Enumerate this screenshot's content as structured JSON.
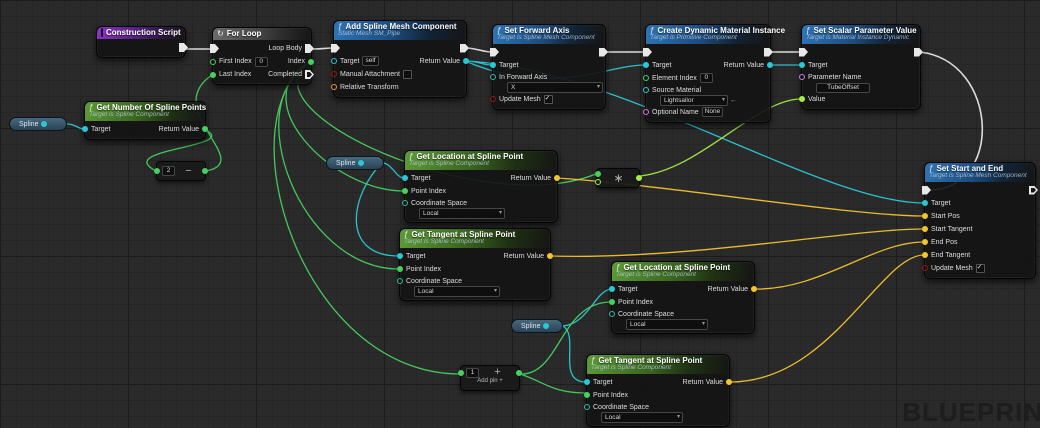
{
  "watermark": "BLUEPRINT",
  "colors": {
    "exec": "#e6e6e6",
    "object": "#2bc8d6",
    "int": "#46d05f",
    "float": "#a3ee44",
    "vector": "#f3c431"
  },
  "icons": {
    "function": "ƒ",
    "loop": "↻",
    "asset_use": "←"
  },
  "nodes": {
    "construction_script": {
      "title": "Construction Script"
    },
    "for_loop": {
      "title": "For Loop",
      "first_index_label": "First Index",
      "first_index_value": "0",
      "last_index_label": "Last Index",
      "loop_body_label": "Loop Body",
      "index_label": "Index",
      "completed_label": "Completed"
    },
    "add_spline_mesh": {
      "title": "Add Spline Mesh Component",
      "subtitle": "Static Mesh SM_Pipe",
      "target_label": "Target",
      "target_value": "self",
      "manual_attachment_label": "Manual Attachment",
      "relative_transform_label": "Relative Transform",
      "return_value_label": "Return Value"
    },
    "set_forward_axis": {
      "title": "Set Forward Axis",
      "subtitle": "Target is Spline Mesh Component",
      "target_label": "Target",
      "in_forward_axis_label": "In Forward Axis",
      "in_forward_axis_value": "X",
      "update_mesh_label": "Update Mesh"
    },
    "create_dynamic_material": {
      "title": "Create Dynamic Material Instance",
      "subtitle": "Target is Primitive Component",
      "target_label": "Target",
      "return_value_label": "Return Value",
      "element_index_label": "Element Index",
      "element_index_value": "0",
      "source_material_label": "Source Material",
      "source_material_value": "Lightsailor",
      "optional_name_label": "Optional Name",
      "optional_name_value": "None"
    },
    "set_scalar_parameter": {
      "title": "Set Scalar Parameter Value",
      "subtitle": "Target is Material Instance Dynamic",
      "target_label": "Target",
      "parameter_name_label": "Parameter Name",
      "parameter_name_value": "TubeOffset",
      "value_label": "Value"
    },
    "get_number_of_spline_points": {
      "title": "Get Number Of Spline Points",
      "subtitle": "Target is Spline Component",
      "target_label": "Target",
      "return_value_label": "Return Value"
    },
    "spline_variable": {
      "label": "Spline"
    },
    "subtract_node": {
      "operator": "−",
      "value": "2"
    },
    "multiply_node": {
      "operator": "∗"
    },
    "add_node": {
      "operator": "+",
      "value": "1",
      "add_pin_label": "Add pin +"
    },
    "get_location_start": {
      "title": "Get Location at Spline Point",
      "subtitle": "Target is Spline Component",
      "target_label": "Target",
      "point_index_label": "Point Index",
      "coordinate_space_label": "Coordinate Space",
      "coordinate_space_value": "Local",
      "return_value_label": "Return Value"
    },
    "get_tangent_start": {
      "title": "Get Tangent at Spline Point",
      "subtitle": "Target is Spline Component",
      "target_label": "Target",
      "point_index_label": "Point Index",
      "coordinate_space_label": "Coordinate Space",
      "coordinate_space_value": "Local",
      "return_value_label": "Return Value"
    },
    "get_location_end": {
      "title": "Get Location at Spline Point",
      "subtitle": "Target is Spline Component",
      "target_label": "Target",
      "point_index_label": "Point Index",
      "coordinate_space_label": "Coordinate Space",
      "coordinate_space_value": "Local",
      "return_value_label": "Return Value"
    },
    "get_tangent_end": {
      "title": "Get Tangent at Spline Point",
      "subtitle": "Target is Spline Component",
      "target_label": "Target",
      "point_index_label": "Point Index",
      "coordinate_space_label": "Coordinate Space",
      "coordinate_space_value": "Local",
      "return_value_label": "Return Value"
    },
    "set_start_and_end": {
      "title": "Set Start and End",
      "subtitle": "Target is Spline Mesh Component",
      "target_label": "Target",
      "start_pos_label": "Start Pos",
      "start_tangent_label": "Start Tangent",
      "end_pos_label": "End Pos",
      "end_tangent_label": "End Tangent",
      "update_mesh_label": "Update Mesh"
    }
  }
}
